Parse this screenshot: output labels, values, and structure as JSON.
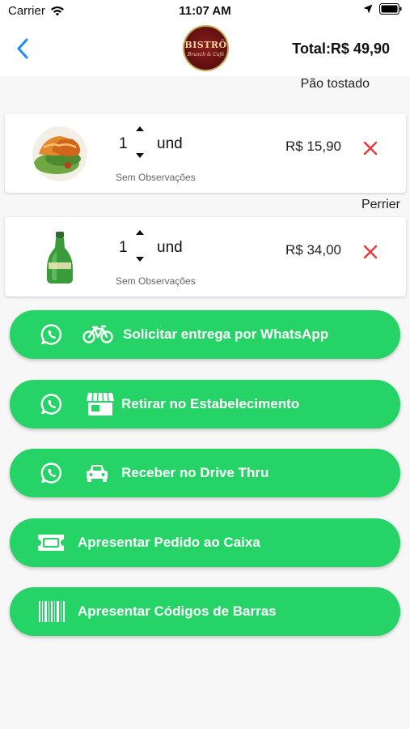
{
  "status_bar": {
    "carrier": "Carrier",
    "time": "11:07 AM"
  },
  "header": {
    "logo_line1": "BISTRÔ",
    "logo_line2": "Brunch & Café",
    "total": "Total:R$ 49,90"
  },
  "cart": {
    "items": [
      {
        "note": "Pão tostado",
        "quantity": "1",
        "unit": "und",
        "observation": "Sem Observações",
        "price": "R$ 15,90",
        "image": "pastry-image"
      },
      {
        "note": "Perrier",
        "quantity": "1",
        "unit": "und",
        "observation": "Sem Observações",
        "price": "R$ 34,00",
        "image": "perrier-bottle-image"
      }
    ]
  },
  "actions": [
    {
      "label": "Solicitar entrega por WhatsApp",
      "icons": [
        "whatsapp-icon",
        "bicycle-icon"
      ]
    },
    {
      "label": "Retirar no Estabelecimento",
      "icons": [
        "whatsapp-icon",
        "store-icon"
      ]
    },
    {
      "label": "Receber no Drive Thru",
      "icons": [
        "whatsapp-icon",
        "car-icon"
      ]
    },
    {
      "label": "Apresentar Pedido ao Caixa",
      "icons": [
        "ticket-icon"
      ]
    },
    {
      "label": "Apresentar Códigos de Barras",
      "icons": [
        "barcode-icon"
      ]
    }
  ],
  "colors": {
    "accent_green": "#25d366",
    "back_blue": "#1a8cff",
    "remove_red": "#e53935"
  }
}
